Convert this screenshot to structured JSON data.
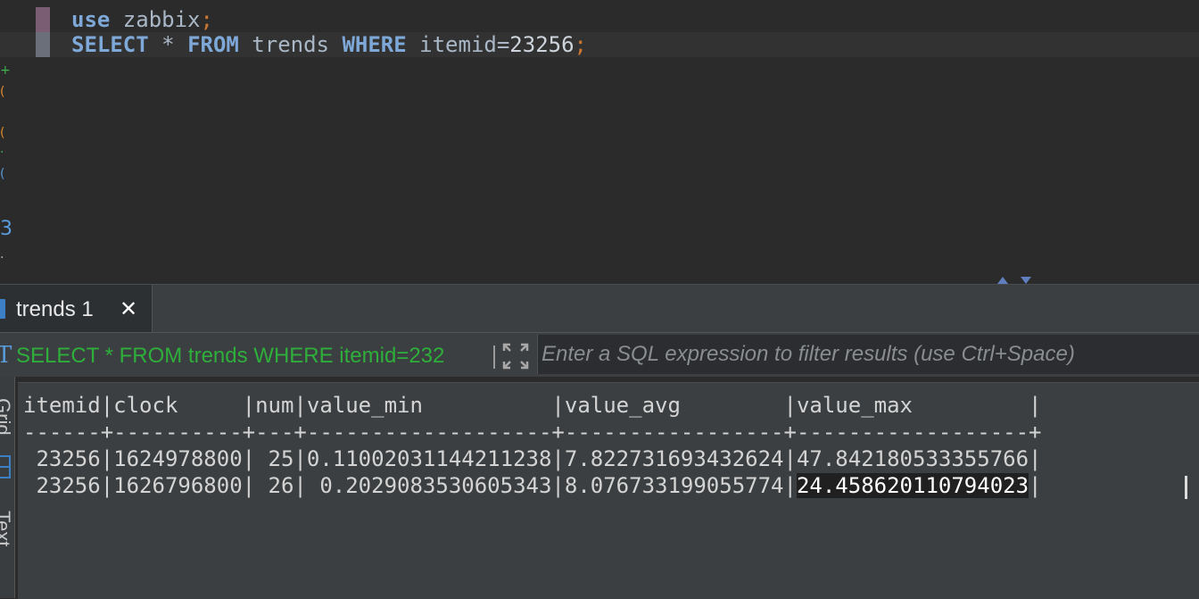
{
  "editor": {
    "line1": {
      "kw": "use",
      "rest": " zabbix",
      "semi": ";"
    },
    "line2": {
      "kw1": "SELECT",
      "t1": " * ",
      "kw2": "FROM",
      "t2": " trends ",
      "kw3": "WHERE",
      "t3": " itemid=",
      "num": "23256",
      "semi": ";"
    }
  },
  "results": {
    "tab_label": "trends 1",
    "filter_query": "SELECT * FROM trends WHERE itemid=232",
    "filter_placeholder": "Enter a SQL expression to filter results (use Ctrl+Space)",
    "side_tabs": [
      "Grid",
      "Text"
    ],
    "text_view": {
      "header": "itemid|clock     |num|value_min          |value_avg        |value_max         |",
      "separator": "------+----------+---+-------------------+-----------------+------------------+",
      "rows": [
        {
          "prefix": " 23256|1624978800| 25|0.11002031144211238|7.822731693432624|",
          "last": "47.842180533355766",
          "suffix": "|"
        },
        {
          "prefix": " 23256|1626796800| 26| 0.2029083530605343|8.076733199055774|",
          "last": "24.458620110794023",
          "suffix": "|"
        }
      ]
    }
  },
  "colors": {
    "keyword": "#7ea8d8",
    "query_green": "#2eae3a",
    "accent_blue": "#3d7fc4"
  }
}
